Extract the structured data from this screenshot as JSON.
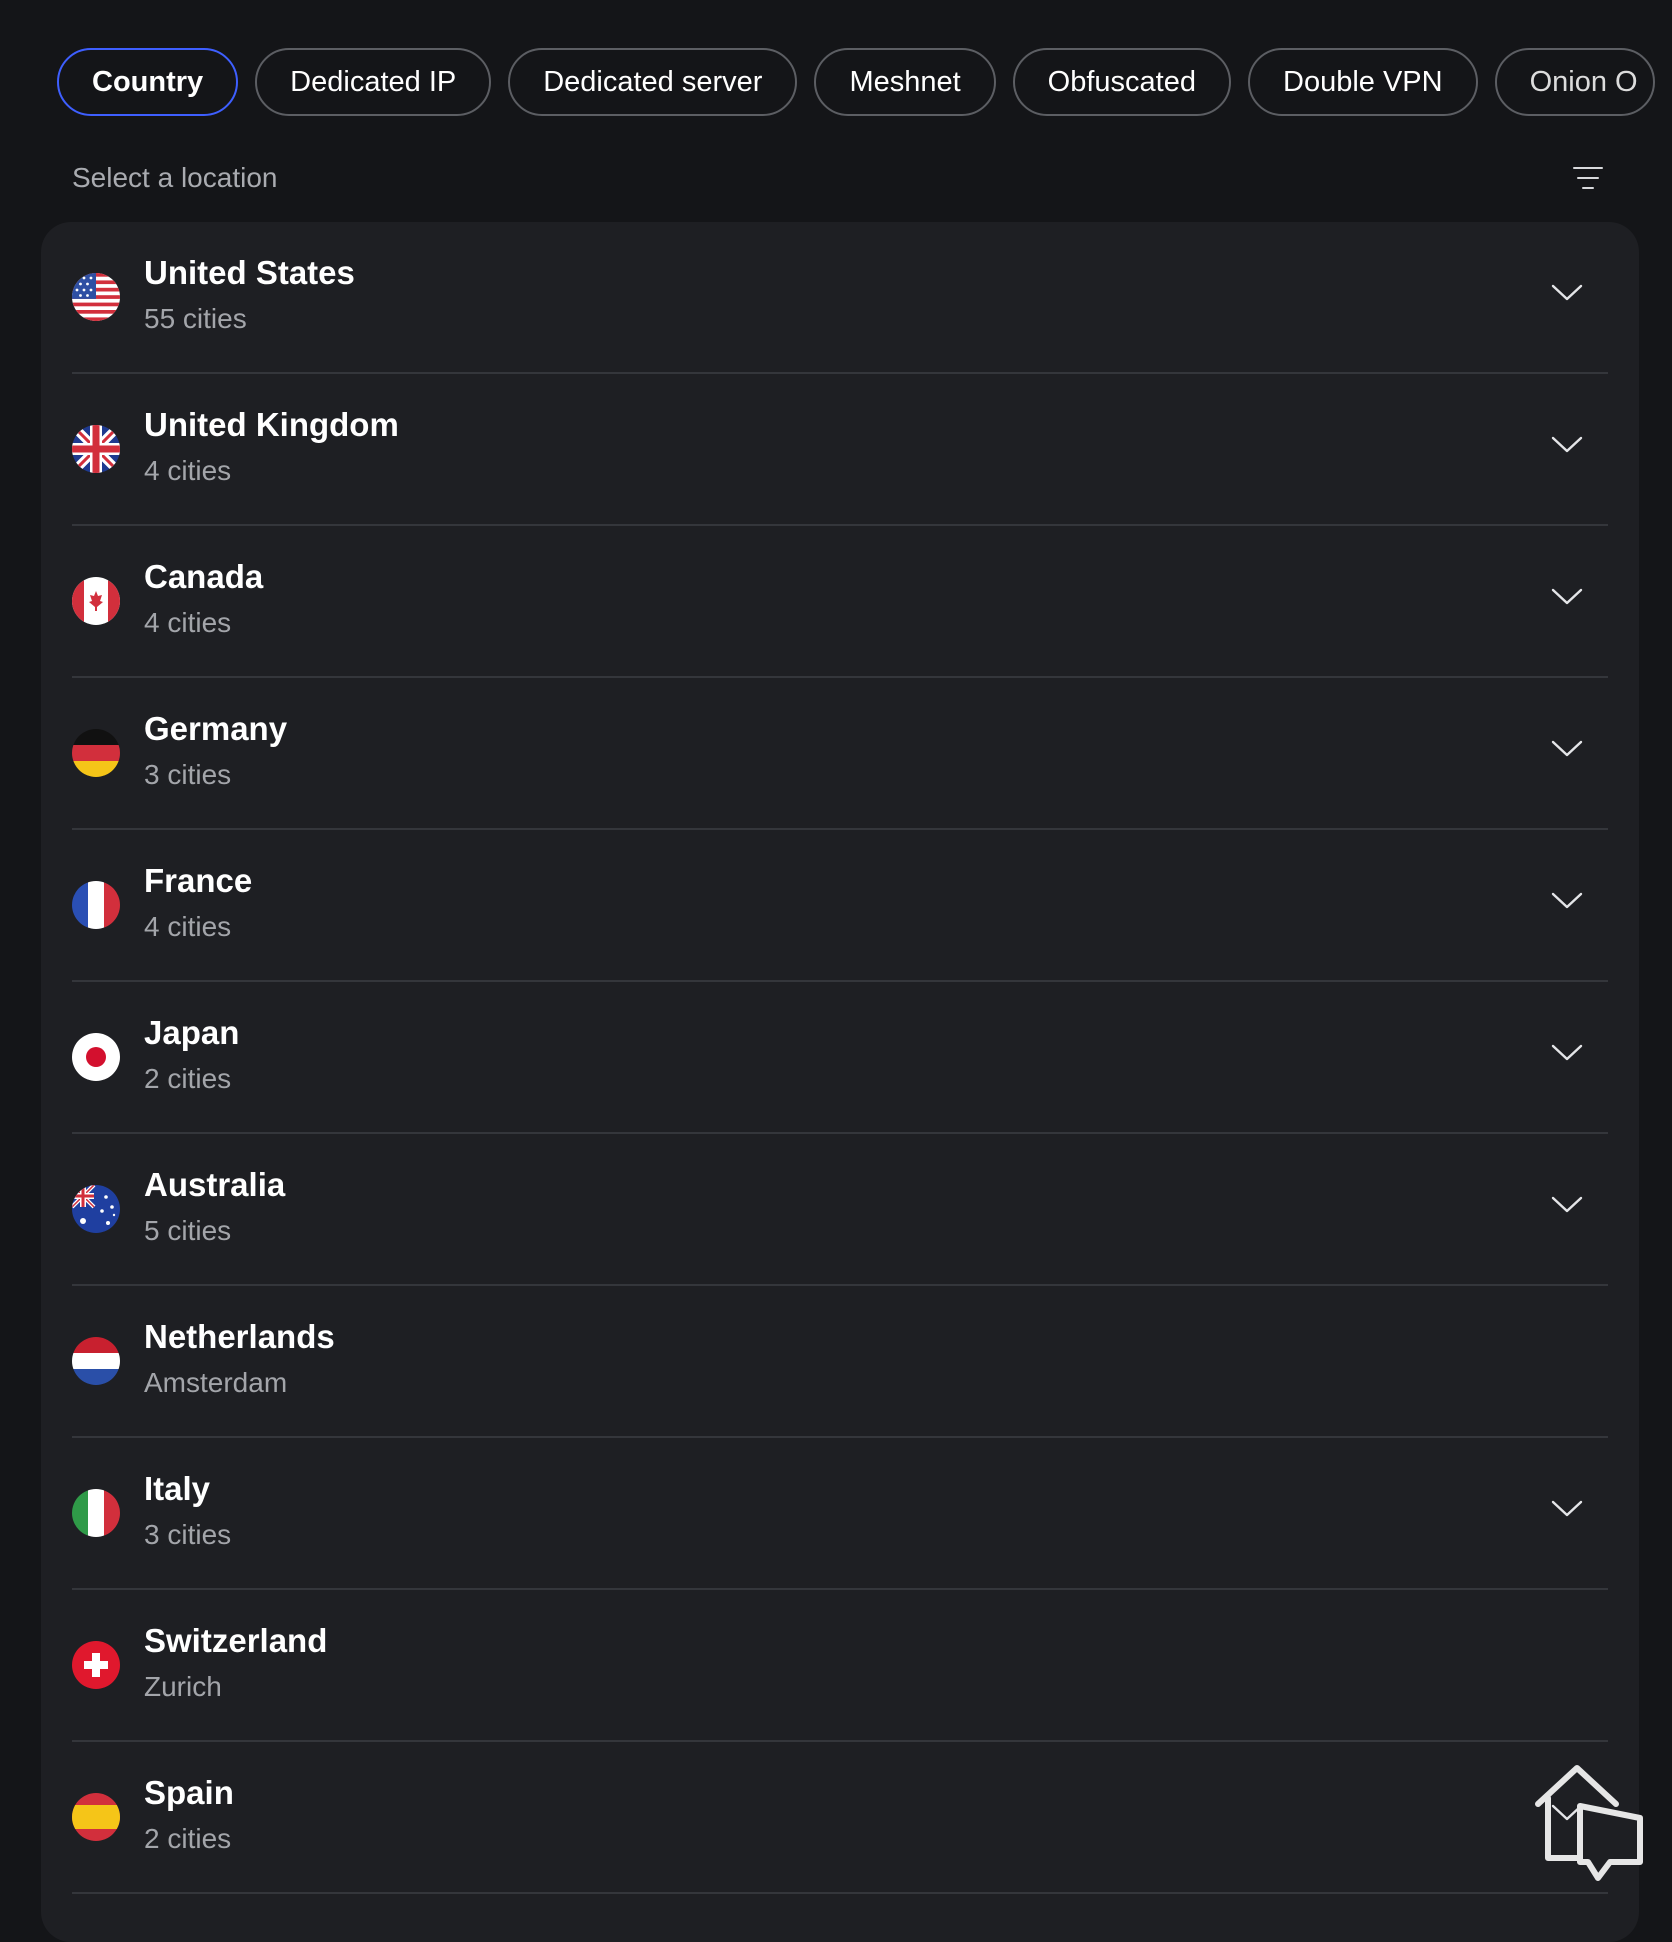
{
  "tabs": [
    {
      "label": "Country",
      "active": true
    },
    {
      "label": "Dedicated IP"
    },
    {
      "label": "Dedicated server"
    },
    {
      "label": "Meshnet"
    },
    {
      "label": "Obfuscated"
    },
    {
      "label": "Double VPN"
    },
    {
      "label": "Onion O"
    }
  ],
  "subheader": {
    "label": "Select a location",
    "sort_icon": "sort-lines-icon"
  },
  "countries": [
    {
      "name": "United States",
      "sub": "55 cities",
      "flag": "us-flag-icon",
      "expandable": true
    },
    {
      "name": "United Kingdom",
      "sub": "4 cities",
      "flag": "uk-flag-icon",
      "expandable": true
    },
    {
      "name": "Canada",
      "sub": "4 cities",
      "flag": "ca-flag-icon",
      "expandable": true
    },
    {
      "name": "Germany",
      "sub": "3 cities",
      "flag": "de-flag-icon",
      "expandable": true
    },
    {
      "name": "France",
      "sub": "4 cities",
      "flag": "fr-flag-icon",
      "expandable": true
    },
    {
      "name": "Japan",
      "sub": "2 cities",
      "flag": "jp-flag-icon",
      "expandable": true
    },
    {
      "name": "Australia",
      "sub": "5 cities",
      "flag": "au-flag-icon",
      "expandable": true
    },
    {
      "name": "Netherlands",
      "sub": "Amsterdam",
      "flag": "nl-flag-icon",
      "expandable": false
    },
    {
      "name": "Italy",
      "sub": "3 cities",
      "flag": "it-flag-icon",
      "expandable": true
    },
    {
      "name": "Switzerland",
      "sub": "Zurich",
      "flag": "ch-flag-icon",
      "expandable": false
    },
    {
      "name": "Spain",
      "sub": "2 cities",
      "flag": "es-flag-icon",
      "expandable": true
    }
  ],
  "colors": {
    "active_tab_border": "#3e5fff",
    "background": "#141518",
    "card": "#1e1f23"
  }
}
